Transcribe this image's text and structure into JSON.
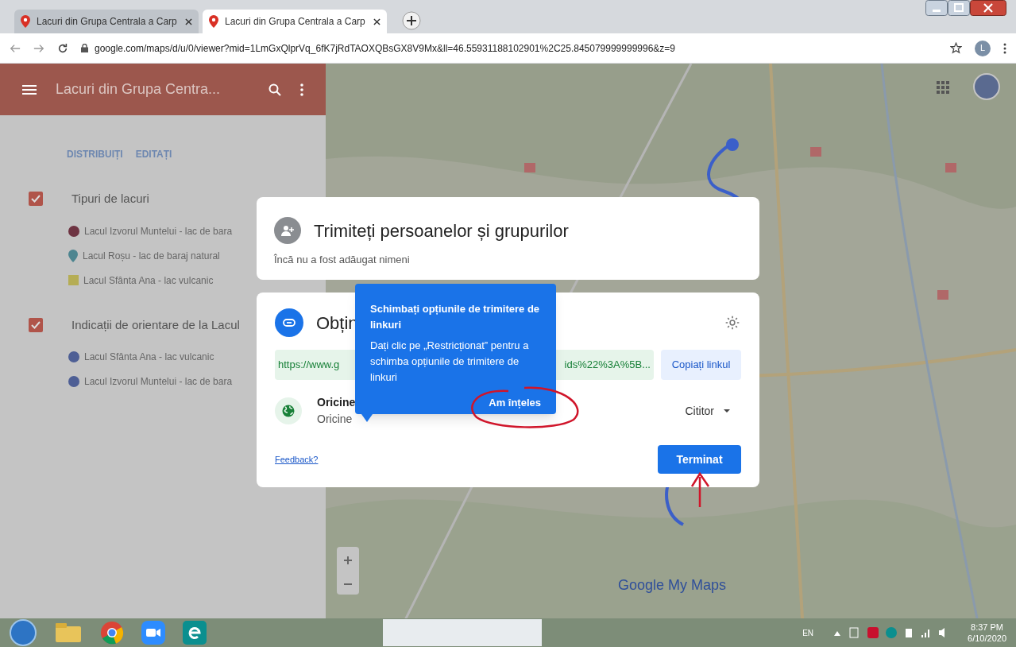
{
  "browser": {
    "tabs": [
      {
        "title": "Lacuri din Grupa Centrala a Carp",
        "selected": false
      },
      {
        "title": "Lacuri din Grupa Centrala a Carp",
        "selected": true
      }
    ],
    "url": "google.com/maps/d/u/0/viewer?mid=1LmGxQlprVq_6fK7jRdTAOXQBsGX8V9Mx&ll=46.55931188102901%2C25.845079999999996&z=9",
    "profile": "L"
  },
  "sidebar": {
    "title": "Lacuri din Grupa Centra...",
    "actions": [
      "DISTRIBUIȚI",
      "EDITAȚI"
    ],
    "layers": [
      {
        "name": "Tipuri de lacuri",
        "checked": true,
        "items": [
          {
            "label": "Lacul Izvorul Muntelui - lac de bara",
            "kind": "circle",
            "color": "#6e3442"
          },
          {
            "label": "Lacul Roșu - lac de baraj natural",
            "kind": "pin",
            "color": "#4d8590"
          },
          {
            "label": "Lacul Sfânta Ana - lac vulcanic",
            "kind": "square",
            "color": "#b5ad55"
          }
        ]
      },
      {
        "name": "Indicații de orientare de la Lacul",
        "checked": true,
        "items": [
          {
            "label": "Lacul Sfânta Ana - lac vulcanic",
            "kind": "circle",
            "color": "#4e5f95"
          },
          {
            "label": "Lacul Izvorul Muntelui - lac de bara",
            "kind": "circle",
            "color": "#4e5f95"
          }
        ]
      }
    ]
  },
  "map": {
    "logo": "Google My Maps"
  },
  "share_dialog": {
    "people": {
      "title": "Trimiteți persoanelor și grupurilor",
      "note": "Încă nu a fost adăugat nimeni"
    },
    "link": {
      "title": "Obțin",
      "url_start": "https://www.g",
      "url_end": "ids%22%3A%5B...",
      "copy": "Copiați linkul",
      "access_title": "Oricine",
      "access_detail": "Oricine",
      "role": "Cititor",
      "feedback": "Feedback?",
      "done": "Terminat"
    },
    "tooltip": {
      "title": "Schimbați opțiunile de trimitere de linkuri",
      "body": "Dați clic pe „Restricționat” pentru a schimba opțiunile de trimitere de linkuri",
      "button": "Am înțeles"
    }
  },
  "taskbar": {
    "language": "EN",
    "time": "8:37 PM",
    "date": "6/10/2020"
  }
}
